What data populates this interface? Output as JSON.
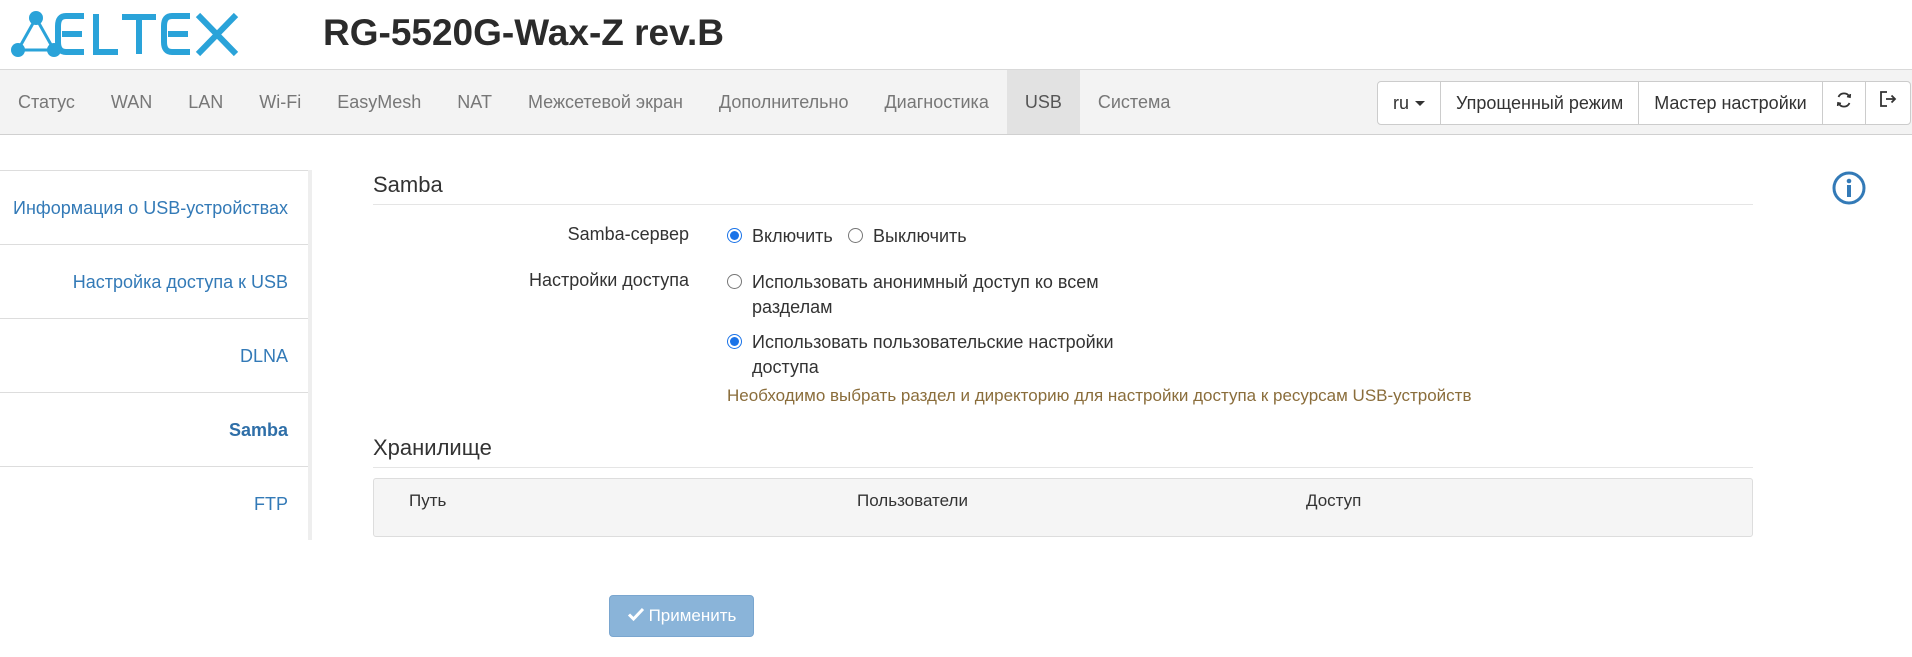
{
  "header": {
    "logo_text": "ELTEX",
    "product_title": "RG-5520G-Wax-Z rev.B"
  },
  "nav": {
    "tabs": [
      {
        "label": "Статус"
      },
      {
        "label": "WAN"
      },
      {
        "label": "LAN"
      },
      {
        "label": "Wi-Fi"
      },
      {
        "label": "EasyMesh"
      },
      {
        "label": "NAT"
      },
      {
        "label": "Межсетевой экран"
      },
      {
        "label": "Дополнительно"
      },
      {
        "label": "Диагностика"
      },
      {
        "label": "USB"
      },
      {
        "label": "Система"
      }
    ],
    "active_tab": "USB",
    "language": "ru",
    "simple_mode_label": "Упрощенный режим",
    "wizard_label": "Мастер настройки",
    "refresh_icon": "refresh-icon",
    "logout_icon": "logout-icon"
  },
  "sidebar": {
    "items": [
      {
        "label": "Информация о USB-устройствах"
      },
      {
        "label": "Настройка доступа к USB"
      },
      {
        "label": "DLNA"
      },
      {
        "label": "Samba"
      },
      {
        "label": "FTP"
      }
    ],
    "active_item": "Samba"
  },
  "samba": {
    "section_title": "Samba",
    "server_label": "Samba-сервер",
    "server_on_label": "Включить",
    "server_off_label": "Выключить",
    "server_value": "on",
    "access_label": "Настройки доступа",
    "access_anon_line1": "Использовать анонимный доступ ко всем",
    "access_anon_line2": "разделам",
    "access_user_line1": "Использовать пользовательские настройки",
    "access_user_line2": "доступа",
    "access_value": "user",
    "hint": "Необходимо выбрать раздел и директорию для настройки доступа к ресурсам USB-устройств"
  },
  "storage": {
    "section_title": "Хранилище",
    "columns": [
      "Путь",
      "Пользователи",
      "Доступ"
    ],
    "rows": []
  },
  "apply_label": "Применить",
  "colors": {
    "accent": "#337ab7",
    "logo": "#2aa3d9",
    "hint": "#8a6d3b",
    "apply_button": "#8ab4d9"
  }
}
